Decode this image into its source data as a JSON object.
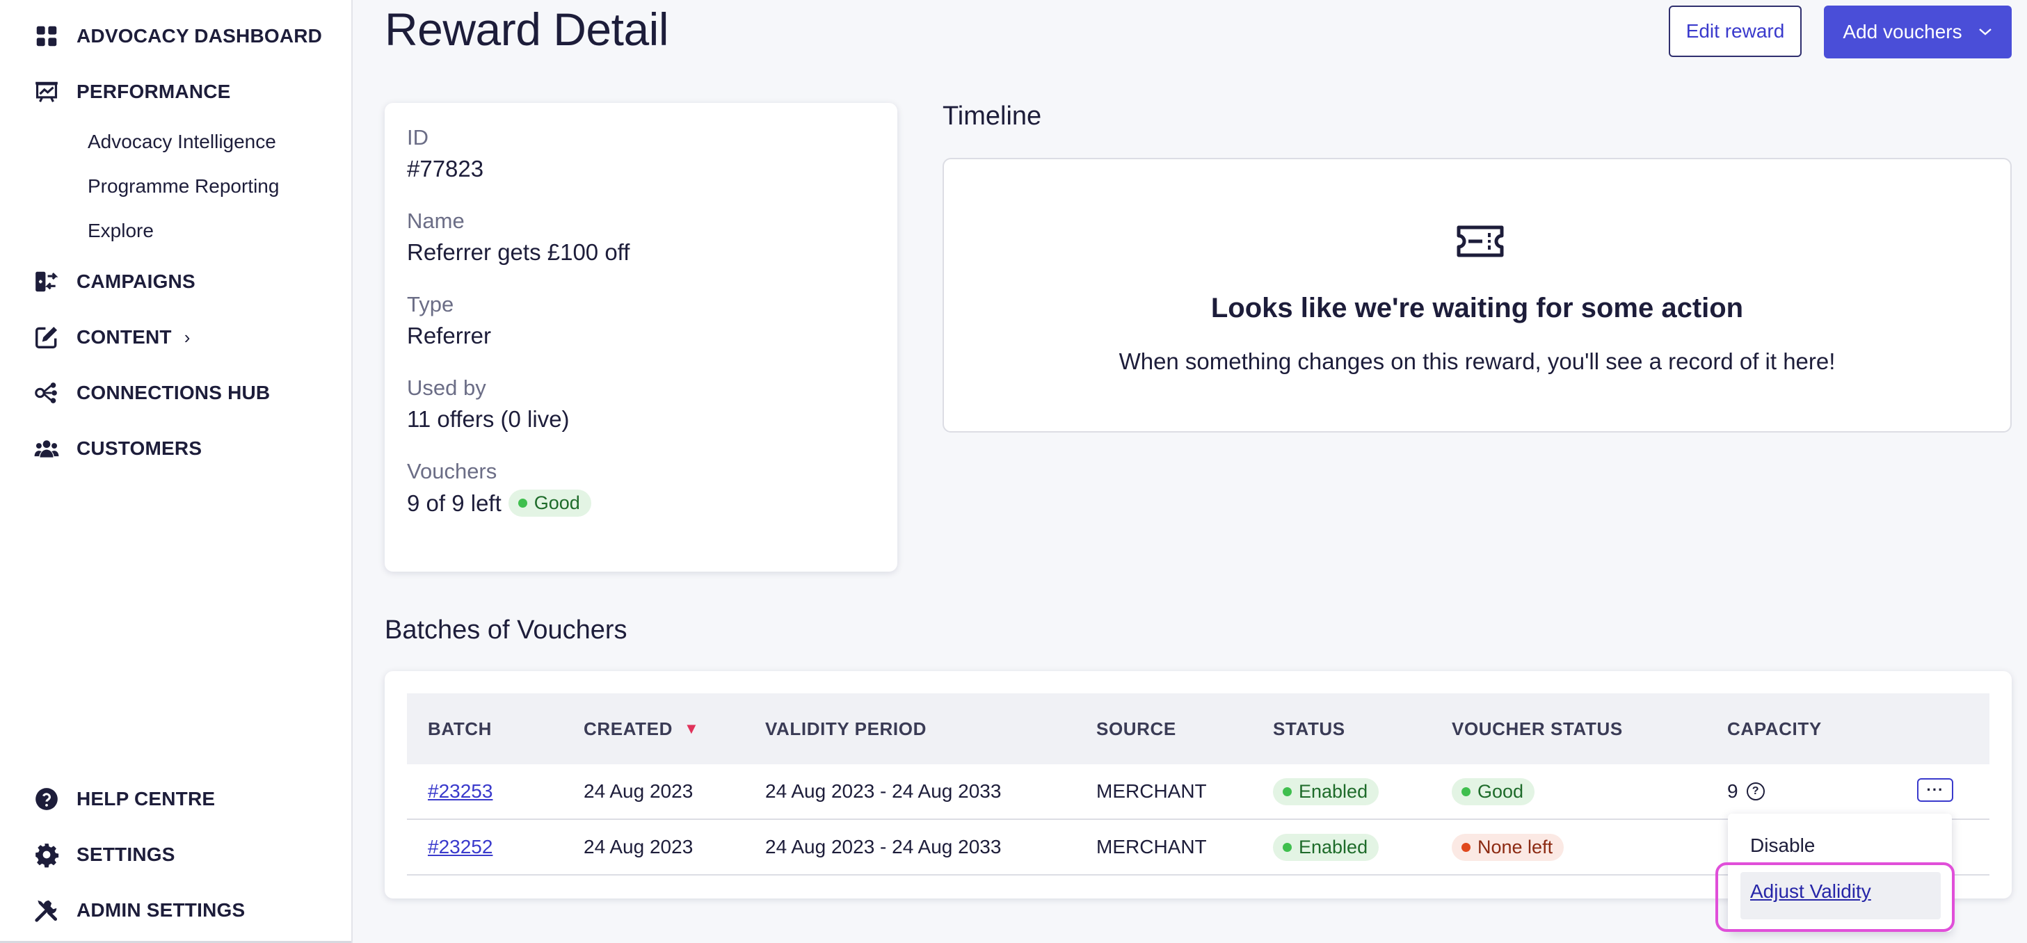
{
  "sidebar": {
    "items": [
      {
        "label": "ADVOCACY DASHBOARD",
        "icon": "dashboard-grid-icon"
      },
      {
        "label": "PERFORMANCE",
        "icon": "presentation-chart-icon"
      },
      {
        "label": "CAMPAIGNS",
        "icon": "campaign-switch-icon"
      },
      {
        "label": "CONTENT",
        "icon": "edit-pencil-icon"
      },
      {
        "label": "CONNECTIONS HUB",
        "icon": "connections-hub-icon"
      },
      {
        "label": "CUSTOMERS",
        "icon": "users-group-icon"
      }
    ],
    "performance_sub": [
      "Advocacy Intelligence",
      "Programme Reporting",
      "Explore"
    ],
    "content_chevron": "›",
    "bottom_items": [
      {
        "label": "HELP CENTRE",
        "icon": "help-circle-icon"
      },
      {
        "label": "SETTINGS",
        "icon": "gear-icon"
      },
      {
        "label": "ADMIN SETTINGS",
        "icon": "tools-icon"
      }
    ]
  },
  "header": {
    "title": "Reward Detail",
    "edit_label": "Edit reward",
    "add_label": "Add vouchers",
    "add_chevron": "⌄"
  },
  "details": {
    "id_label": "ID",
    "id_value": "#77823",
    "name_label": "Name",
    "name_value": "Referrer gets £100 off",
    "type_label": "Type",
    "type_value": "Referrer",
    "used_label": "Used by",
    "used_value": "11 offers (0 live)",
    "vouchers_label": "Vouchers",
    "vouchers_value": "9 of 9 left",
    "vouchers_badge": "Good"
  },
  "timeline": {
    "title": "Timeline",
    "heading": "Looks like we're waiting for some action",
    "text": "When something changes on this reward, you'll see a record of it here!"
  },
  "batches": {
    "title": "Batches of Vouchers",
    "columns": [
      "BATCH",
      "CREATED",
      "VALIDITY PERIOD",
      "SOURCE",
      "STATUS",
      "VOUCHER STATUS",
      "CAPACITY"
    ],
    "sort_indicator": "▼",
    "rows": [
      {
        "batch": "#23253",
        "created": "24 Aug 2023",
        "validity": "24 Aug 2023 - 24 Aug 2033",
        "source": "MERCHANT",
        "status": "Enabled",
        "voucher_status": "Good",
        "capacity": "9"
      },
      {
        "batch": "#23252",
        "created": "24 Aug 2023",
        "validity": "24 Aug 2023 - 24 Aug 2033",
        "source": "MERCHANT",
        "status": "Enabled",
        "voucher_status": "None left",
        "capacity": ""
      }
    ],
    "help_glyph": "?",
    "more_label": "···"
  },
  "row_menu": {
    "items": [
      "Disable",
      "Adjust Validity"
    ]
  },
  "colors": {
    "accent": "#4a4ed8",
    "highlight": "#e04fd9",
    "good": "#3fbf4e",
    "none_left": "#e0481d"
  }
}
